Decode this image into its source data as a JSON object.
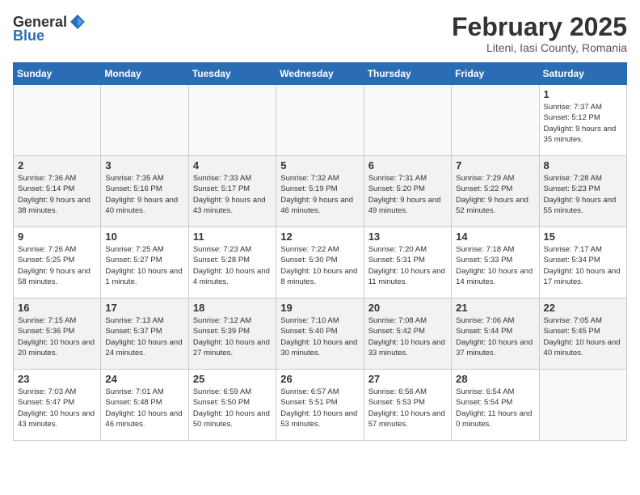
{
  "header": {
    "logo_general": "General",
    "logo_blue": "Blue",
    "month_title": "February 2025",
    "location": "Liteni, Iasi County, Romania"
  },
  "calendar": {
    "days_of_week": [
      "Sunday",
      "Monday",
      "Tuesday",
      "Wednesday",
      "Thursday",
      "Friday",
      "Saturday"
    ],
    "weeks": [
      {
        "shaded": false,
        "days": [
          {
            "num": "",
            "info": ""
          },
          {
            "num": "",
            "info": ""
          },
          {
            "num": "",
            "info": ""
          },
          {
            "num": "",
            "info": ""
          },
          {
            "num": "",
            "info": ""
          },
          {
            "num": "",
            "info": ""
          },
          {
            "num": "1",
            "info": "Sunrise: 7:37 AM\nSunset: 5:12 PM\nDaylight: 9 hours and 35 minutes."
          }
        ]
      },
      {
        "shaded": true,
        "days": [
          {
            "num": "2",
            "info": "Sunrise: 7:36 AM\nSunset: 5:14 PM\nDaylight: 9 hours and 38 minutes."
          },
          {
            "num": "3",
            "info": "Sunrise: 7:35 AM\nSunset: 5:16 PM\nDaylight: 9 hours and 40 minutes."
          },
          {
            "num": "4",
            "info": "Sunrise: 7:33 AM\nSunset: 5:17 PM\nDaylight: 9 hours and 43 minutes."
          },
          {
            "num": "5",
            "info": "Sunrise: 7:32 AM\nSunset: 5:19 PM\nDaylight: 9 hours and 46 minutes."
          },
          {
            "num": "6",
            "info": "Sunrise: 7:31 AM\nSunset: 5:20 PM\nDaylight: 9 hours and 49 minutes."
          },
          {
            "num": "7",
            "info": "Sunrise: 7:29 AM\nSunset: 5:22 PM\nDaylight: 9 hours and 52 minutes."
          },
          {
            "num": "8",
            "info": "Sunrise: 7:28 AM\nSunset: 5:23 PM\nDaylight: 9 hours and 55 minutes."
          }
        ]
      },
      {
        "shaded": false,
        "days": [
          {
            "num": "9",
            "info": "Sunrise: 7:26 AM\nSunset: 5:25 PM\nDaylight: 9 hours and 58 minutes."
          },
          {
            "num": "10",
            "info": "Sunrise: 7:25 AM\nSunset: 5:27 PM\nDaylight: 10 hours and 1 minute."
          },
          {
            "num": "11",
            "info": "Sunrise: 7:23 AM\nSunset: 5:28 PM\nDaylight: 10 hours and 4 minutes."
          },
          {
            "num": "12",
            "info": "Sunrise: 7:22 AM\nSunset: 5:30 PM\nDaylight: 10 hours and 8 minutes."
          },
          {
            "num": "13",
            "info": "Sunrise: 7:20 AM\nSunset: 5:31 PM\nDaylight: 10 hours and 11 minutes."
          },
          {
            "num": "14",
            "info": "Sunrise: 7:18 AM\nSunset: 5:33 PM\nDaylight: 10 hours and 14 minutes."
          },
          {
            "num": "15",
            "info": "Sunrise: 7:17 AM\nSunset: 5:34 PM\nDaylight: 10 hours and 17 minutes."
          }
        ]
      },
      {
        "shaded": true,
        "days": [
          {
            "num": "16",
            "info": "Sunrise: 7:15 AM\nSunset: 5:36 PM\nDaylight: 10 hours and 20 minutes."
          },
          {
            "num": "17",
            "info": "Sunrise: 7:13 AM\nSunset: 5:37 PM\nDaylight: 10 hours and 24 minutes."
          },
          {
            "num": "18",
            "info": "Sunrise: 7:12 AM\nSunset: 5:39 PM\nDaylight: 10 hours and 27 minutes."
          },
          {
            "num": "19",
            "info": "Sunrise: 7:10 AM\nSunset: 5:40 PM\nDaylight: 10 hours and 30 minutes."
          },
          {
            "num": "20",
            "info": "Sunrise: 7:08 AM\nSunset: 5:42 PM\nDaylight: 10 hours and 33 minutes."
          },
          {
            "num": "21",
            "info": "Sunrise: 7:06 AM\nSunset: 5:44 PM\nDaylight: 10 hours and 37 minutes."
          },
          {
            "num": "22",
            "info": "Sunrise: 7:05 AM\nSunset: 5:45 PM\nDaylight: 10 hours and 40 minutes."
          }
        ]
      },
      {
        "shaded": false,
        "days": [
          {
            "num": "23",
            "info": "Sunrise: 7:03 AM\nSunset: 5:47 PM\nDaylight: 10 hours and 43 minutes."
          },
          {
            "num": "24",
            "info": "Sunrise: 7:01 AM\nSunset: 5:48 PM\nDaylight: 10 hours and 46 minutes."
          },
          {
            "num": "25",
            "info": "Sunrise: 6:59 AM\nSunset: 5:50 PM\nDaylight: 10 hours and 50 minutes."
          },
          {
            "num": "26",
            "info": "Sunrise: 6:57 AM\nSunset: 5:51 PM\nDaylight: 10 hours and 53 minutes."
          },
          {
            "num": "27",
            "info": "Sunrise: 6:56 AM\nSunset: 5:53 PM\nDaylight: 10 hours and 57 minutes."
          },
          {
            "num": "28",
            "info": "Sunrise: 6:54 AM\nSunset: 5:54 PM\nDaylight: 11 hours and 0 minutes."
          },
          {
            "num": "",
            "info": ""
          }
        ]
      }
    ]
  }
}
